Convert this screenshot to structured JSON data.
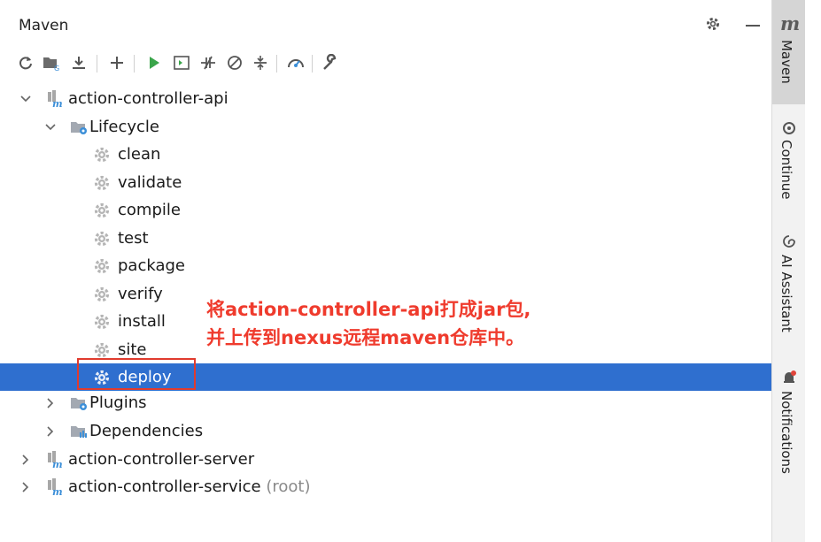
{
  "panel": {
    "title": "Maven"
  },
  "toolbar": {
    "icons": [
      "reload-icon",
      "generate-sources-icon",
      "download-icon",
      "add-icon",
      "run-icon",
      "execute-goal-icon",
      "toggle-offline-icon",
      "skip-tests-icon",
      "collapse-all-icon",
      "analyze-dependencies-icon",
      "settings-wrench-icon"
    ]
  },
  "tree": {
    "api": "action-controller-api",
    "lifecycle": "Lifecycle",
    "goals": [
      "clean",
      "validate",
      "compile",
      "test",
      "package",
      "verify",
      "install",
      "site",
      "deploy"
    ],
    "plugins": "Plugins",
    "dependencies": "Dependencies",
    "server": "action-controller-server",
    "service": "action-controller-service",
    "service_suffix": "(root)"
  },
  "annotation": {
    "line1": "将action-controller-api打成jar包,",
    "line2": "并上传到nexus远程maven仓库中。"
  },
  "sidebar": {
    "maven_logo": "m",
    "maven": "Maven",
    "continue": "Continue",
    "ai_assistant": "AI Assistant",
    "notifications": "Notifications"
  },
  "colors": {
    "selection": "#2f6fcf",
    "annotation": "#ef3b2d",
    "run_green": "#3aa54a",
    "module_blue": "#3c8fd8"
  }
}
